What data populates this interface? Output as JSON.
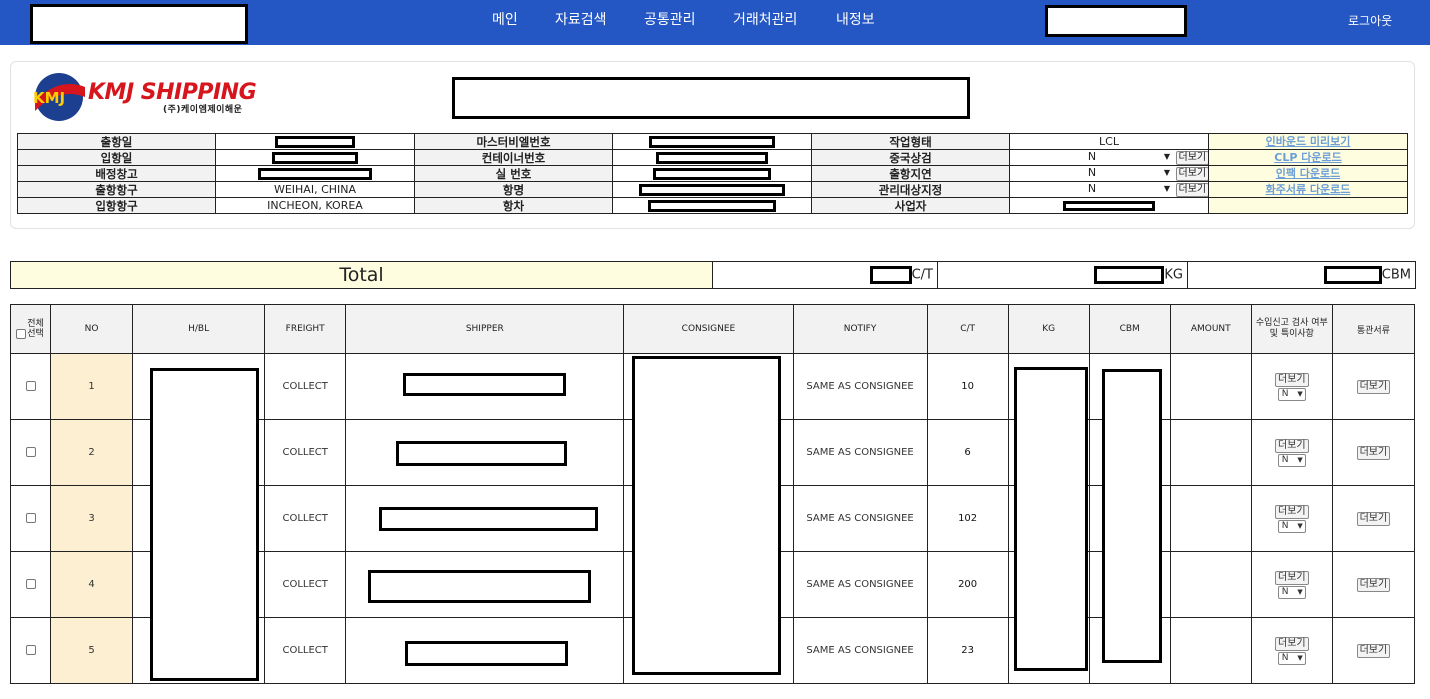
{
  "nav": {
    "items": [
      "메인",
      "자료검색",
      "공통관리",
      "거래처관리",
      "내정보"
    ],
    "logout": "로그아웃"
  },
  "brand": {
    "name": "KMJ SHIPPING",
    "sub": "(주)케이엠제이해운",
    "logo_letters": "KMJ"
  },
  "info_rows": [
    {
      "l1": "출항일",
      "v1": "",
      "l2": "마스터비엘번호",
      "v2": "",
      "l3": "작업형태",
      "v3": "LCL",
      "link": "인바운드 미리보기"
    },
    {
      "l1": "입항일",
      "v1": "",
      "l2": "컨테이너번호",
      "v2": "",
      "l3": "중국상검",
      "v3": "N",
      "link": "CLP 다운로드"
    },
    {
      "l1": "배정창고",
      "v1": "",
      "l2": "실 번호",
      "v2": "",
      "l3": "출항지연",
      "v3": "N",
      "link": "인팩 다운로드"
    },
    {
      "l1": "출항항구",
      "v1": "WEIHAI, CHINA",
      "l2": "항명",
      "v2": "",
      "l3": "관리대상지정",
      "v3": "N",
      "link": "화주서류 다운로드"
    },
    {
      "l1": "입항항구",
      "v1": "INCHEON, KOREA",
      "l2": "항차",
      "v2": "",
      "l3": "사업자",
      "v3": "",
      "link": ""
    }
  ],
  "more_button": "더보기",
  "total": {
    "label": "Total",
    "ct_unit": "C/T",
    "kg_unit": "KG",
    "cbm_unit": "CBM"
  },
  "table": {
    "headers": {
      "select_all": "전체\n선택",
      "no": "NO",
      "hbl": "H/BL",
      "freight": "FREIGHT",
      "shipper": "SHIPPER",
      "consignee": "CONSIGNEE",
      "notify": "NOTIFY",
      "ct": "C/T",
      "kg": "KG",
      "cbm": "CBM",
      "amount": "AMOUNT",
      "inspect": "수입신고 검사 여부 및 특이사항",
      "docs": "통관서류"
    },
    "rows": [
      {
        "no": "1",
        "freight": "COLLECT",
        "notify": "SAME AS CONSIGNEE",
        "ct": "10",
        "amount": "",
        "flag": "N"
      },
      {
        "no": "2",
        "freight": "COLLECT",
        "notify": "SAME AS CONSIGNEE",
        "ct": "6",
        "amount": "",
        "flag": "N"
      },
      {
        "no": "3",
        "freight": "COLLECT",
        "notify": "SAME AS CONSIGNEE",
        "ct": "102",
        "amount": "",
        "flag": "N"
      },
      {
        "no": "4",
        "freight": "COLLECT",
        "notify": "SAME AS CONSIGNEE",
        "ct": "200",
        "amount": "",
        "flag": "N"
      },
      {
        "no": "5",
        "freight": "COLLECT",
        "notify": "SAME AS CONSIGNEE",
        "ct": "23",
        "amount": "",
        "flag": "N"
      }
    ]
  },
  "colors": {
    "nav_bg": "#2456c4",
    "brand_red": "#d7151c",
    "label_bg": "#f2f2f2",
    "highlight_bg": "#fffde0",
    "no_bg": "#fcefd2",
    "link": "#6b9fd6"
  }
}
